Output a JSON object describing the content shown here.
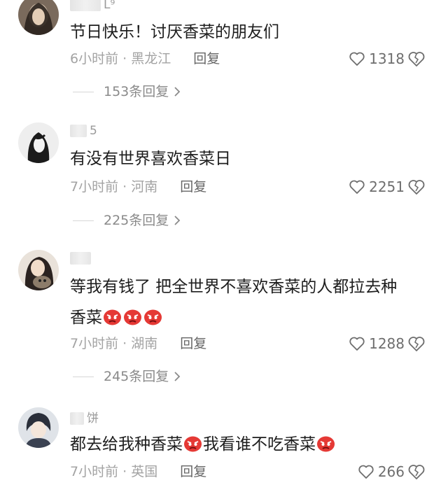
{
  "comments": [
    {
      "username_visible": "L⁹",
      "text_parts": [
        "节日快乐！讨厌香菜的朋友们"
      ],
      "time": "6小时前",
      "location": "黑龙江",
      "reply_label": "回复",
      "likes": "1318",
      "replies_label": "153条回复",
      "avatar": "dark-hair-avatar"
    },
    {
      "username_visible": "5",
      "text_parts": [
        "有没有世界喜欢香菜日"
      ],
      "time": "7小时前",
      "location": "河南",
      "reply_label": "回复",
      "likes": "2251",
      "replies_label": "225条回复",
      "avatar": "sketch-avatar"
    },
    {
      "username_visible": "",
      "text_line1": "等我有钱了 把全世界不喜欢香菜的人都拉去种",
      "text_line2": "香菜",
      "time": "7小时前",
      "location": "湖南",
      "reply_label": "回复",
      "likes": "1288",
      "replies_label": "245条回复",
      "avatar": "girl-with-cat-avatar"
    },
    {
      "username_visible": "饼",
      "text_a": "都去给我种香菜",
      "text_b": "我看谁不吃香菜",
      "time": "7小时前",
      "location": "英国",
      "reply_label": "回复",
      "likes": "266",
      "avatar": "anime-avatar"
    }
  ],
  "meta_separator": "·",
  "icons": {
    "like": "heart-outline-icon",
    "dislike": "broken-heart-icon",
    "expand": "chevron-right-icon",
    "angry": "angry-emoji-icon"
  },
  "colors": {
    "meta": "#a3a3a3",
    "emoji": "#e53935"
  }
}
